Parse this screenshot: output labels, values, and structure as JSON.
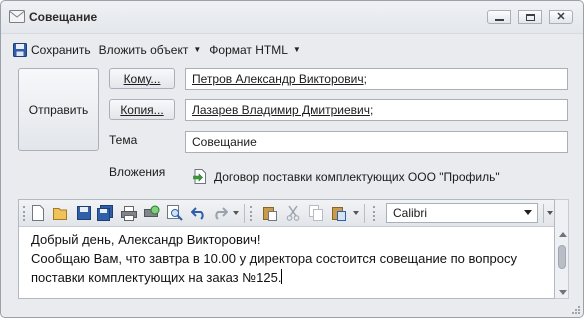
{
  "window": {
    "title": "Совещание",
    "controls": {
      "minimize_icon": "minimize-icon",
      "maximize_icon": "maximize-icon",
      "close_icon": "close-icon"
    }
  },
  "menubar": {
    "save": "Сохранить",
    "attach": "Вложить объект",
    "format": "Формат HTML"
  },
  "compose": {
    "send": "Отправить",
    "to_button": "Кому...",
    "to_value": "Петров Александр Викторович",
    "to_suffix": ";",
    "cc_button": "Копия...",
    "cc_value": "Лазарев Владимир Дмитриевич",
    "cc_suffix": ";",
    "subject_label": "Тема",
    "subject_value": "Совещание",
    "attachments_label": "Вложения",
    "attachment_name": "Договор поставки комплектующих ООО \"Профиль\""
  },
  "editor": {
    "font": "Calibri",
    "toolbar_icons": [
      "new-document-icon",
      "open-folder-icon",
      "save-icon",
      "save-all-icon",
      "print-icon",
      "print-preview-icon",
      "zoom-icon",
      "undo-icon",
      "redo-icon",
      "paste-icon",
      "cut-icon",
      "copy-icon",
      "paste-special-icon"
    ],
    "body_lines": [
      "Добрый день, Александр Викторович!",
      "Сообщаю Вам, что завтра в 10.00 у директора состоится совещание по вопросу",
      "поставки комплектующих на заказ №125."
    ]
  },
  "colors": {
    "window_bg": "#e9ebee",
    "border": "#a9b0b9",
    "save_icon": "#2f5fa8",
    "attach_icon": "#3d9a3a"
  }
}
